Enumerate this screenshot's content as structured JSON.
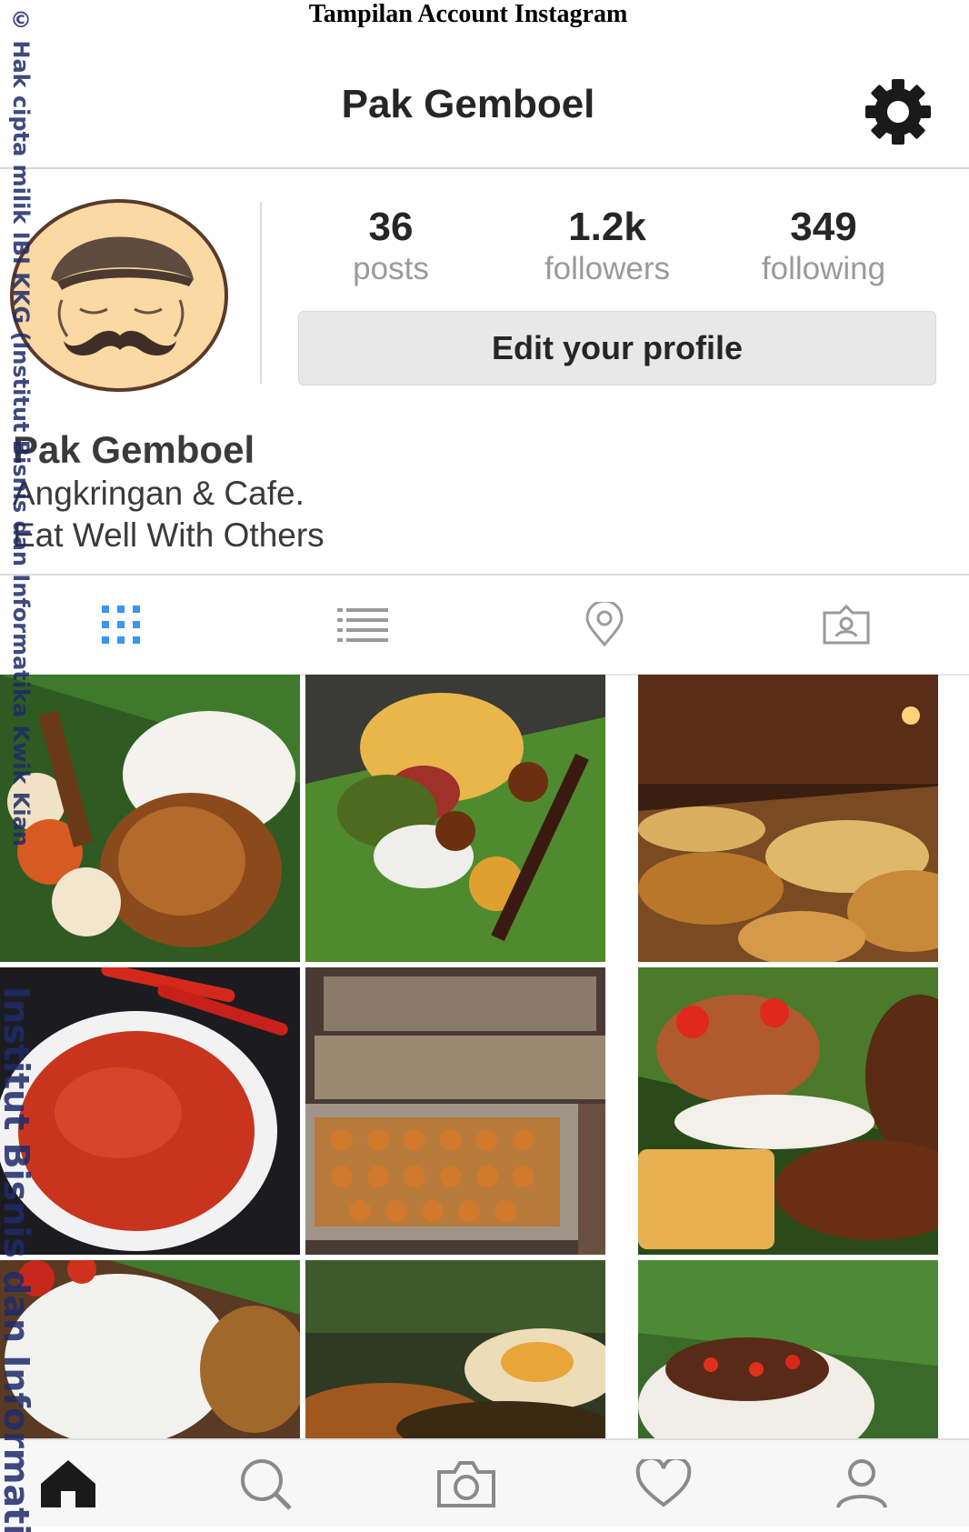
{
  "document": {
    "caption": "Tampilan Account Instagram"
  },
  "header": {
    "title": "Pak Gemboel",
    "settings_icon": "gear-icon"
  },
  "profile": {
    "avatar_icon": "mustache-man-avatar",
    "stats": [
      {
        "value": "36",
        "label": "posts"
      },
      {
        "value": "1.2k",
        "label": "followers"
      },
      {
        "value": "349",
        "label": "following"
      }
    ],
    "edit_button": "Edit your profile",
    "name": "Pak Gemboel",
    "bio_lines": [
      "Angkringan & Cafe.",
      "Eat Well With Others"
    ]
  },
  "tabs": [
    {
      "icon": "grid-icon",
      "active": true
    },
    {
      "icon": "list-icon",
      "active": false
    },
    {
      "icon": "location-pin-icon",
      "active": false
    },
    {
      "icon": "tagged-photos-icon",
      "active": false
    }
  ],
  "posts": [
    {
      "subject": "nasi kucing with satay and fried chicken"
    },
    {
      "subject": "banana leaf wrapped rice with sate"
    },
    {
      "subject": "angkringan buffet spread"
    },
    {
      "subject": "sambal in white bowl"
    },
    {
      "subject": "trays of quail egg satay"
    },
    {
      "subject": "fried chicken with sambal and tempe"
    },
    {
      "subject": "rice with fried shallots"
    },
    {
      "subject": "egg and vegetables close-up"
    },
    {
      "subject": "rice with chopped chili on leaf"
    }
  ],
  "bottom_nav": [
    {
      "icon": "home-icon",
      "active": true
    },
    {
      "icon": "search-icon",
      "active": false
    },
    {
      "icon": "camera-icon",
      "active": false
    },
    {
      "icon": "heart-icon",
      "active": false
    },
    {
      "icon": "profile-icon",
      "active": false
    }
  ],
  "watermark": {
    "top": "© Hak cipta milik IBI KKG (Institut Bisnis dan Informatika Kwik Kian Gie)",
    "bottom": "Institut Bisnis dan Informatika"
  },
  "colors": {
    "accent_blue": "#3897f0",
    "text": "#262626",
    "muted": "#9a9a9a",
    "watermark": "#1e2b6a"
  }
}
